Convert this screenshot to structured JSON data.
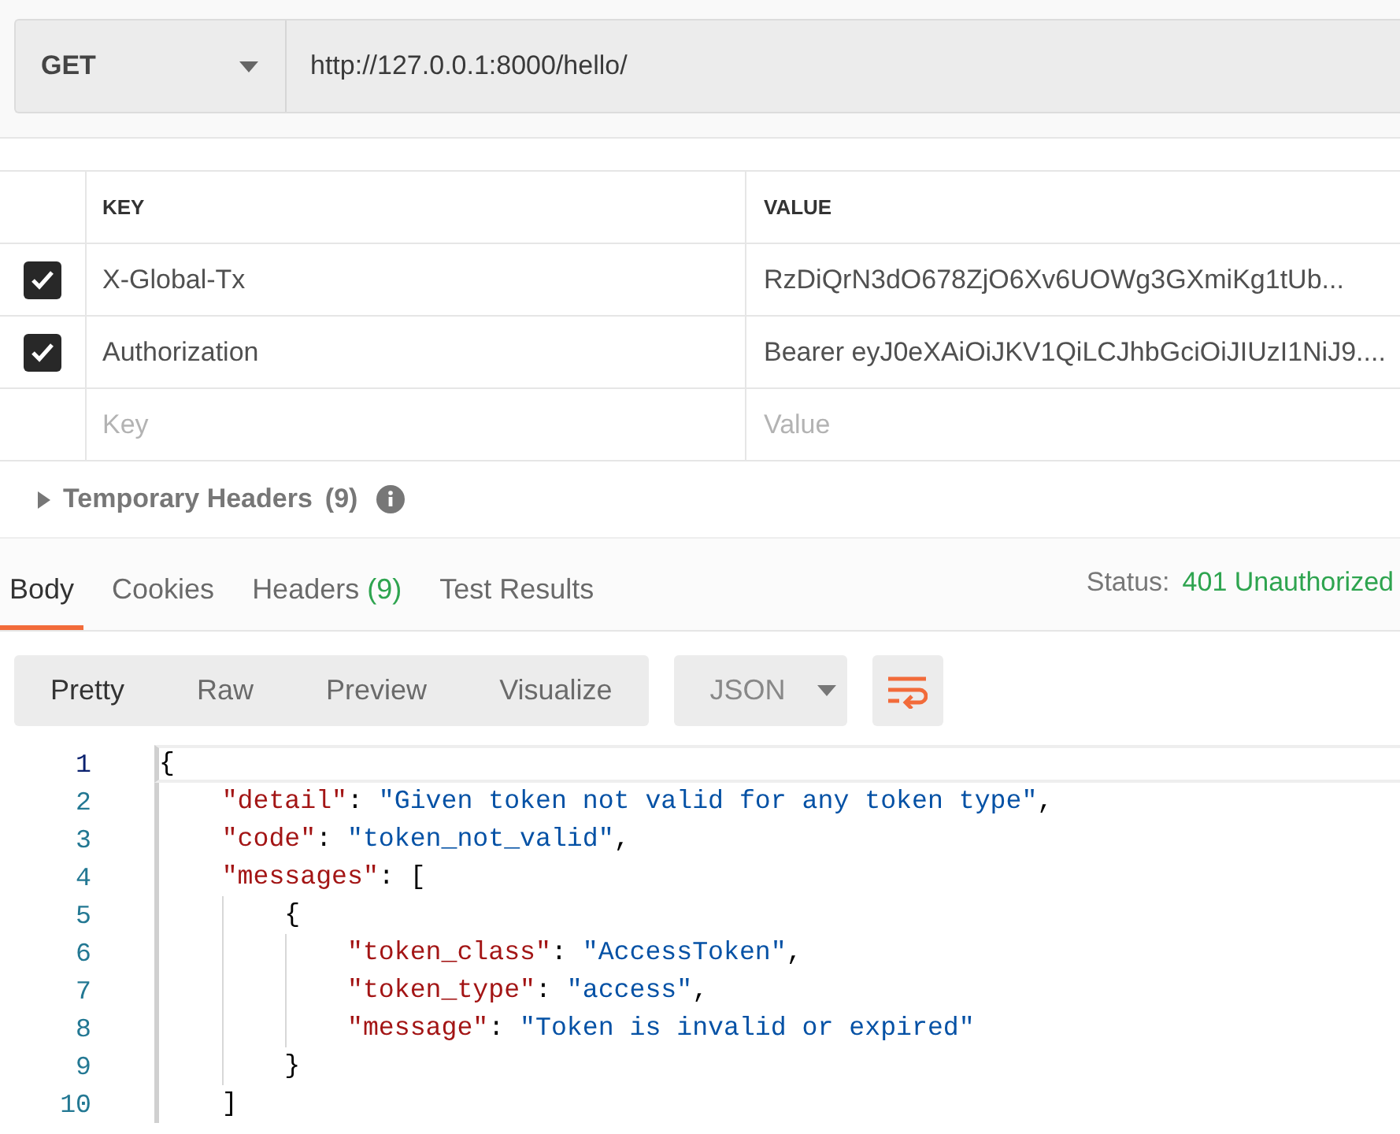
{
  "request": {
    "method": "GET",
    "url": "http://127.0.0.1:8000/hello/"
  },
  "headers_table": {
    "columns": [
      "KEY",
      "VALUE"
    ],
    "rows": [
      {
        "checked": true,
        "key": "X-Global-Tx",
        "value": "RzDiQrN3dO678ZjO6Xv6UOWg3GXmiKg1tUb..."
      },
      {
        "checked": true,
        "key": "Authorization",
        "value": "Bearer eyJ0eXAiOiJKV1QiLCJhbGciOiJIUzI1NiJ9...."
      }
    ],
    "new_row": {
      "key_placeholder": "Key",
      "value_placeholder": "Value"
    }
  },
  "temporary_headers": {
    "title": "Temporary Headers",
    "count": "(9)",
    "expanded": false
  },
  "response_tabs": [
    {
      "label": "Body",
      "selected": true
    },
    {
      "label": "Cookies",
      "selected": false
    },
    {
      "label": "Headers",
      "count": "(9)",
      "selected": false
    },
    {
      "label": "Test Results",
      "selected": false
    }
  ],
  "status": {
    "label": "Status:",
    "value": "401 Unauthorized"
  },
  "view_modes": [
    {
      "label": "Pretty",
      "selected": true
    },
    {
      "label": "Raw",
      "selected": false
    },
    {
      "label": "Preview",
      "selected": false
    },
    {
      "label": "Visualize",
      "selected": false
    }
  ],
  "format": "JSON",
  "code_lines": [
    {
      "number": "1",
      "tokens": [
        {
          "kind": "punct",
          "text": "{"
        }
      ]
    },
    {
      "number": "2",
      "tokens": [
        {
          "kind": "key",
          "text": "    \"detail\""
        },
        {
          "kind": "punct",
          "text": ": "
        },
        {
          "kind": "string",
          "text": "\"Given token not valid for any token type\""
        },
        {
          "kind": "punct",
          "text": ","
        }
      ]
    },
    {
      "number": "3",
      "tokens": [
        {
          "kind": "key",
          "text": "    \"code\""
        },
        {
          "kind": "punct",
          "text": ": "
        },
        {
          "kind": "string",
          "text": "\"token_not_valid\""
        },
        {
          "kind": "punct",
          "text": ","
        }
      ]
    },
    {
      "number": "4",
      "tokens": [
        {
          "kind": "key",
          "text": "    \"messages\""
        },
        {
          "kind": "punct",
          "text": ": ["
        }
      ]
    },
    {
      "number": "5",
      "tokens": [
        {
          "kind": "punct",
          "text": "        {"
        }
      ]
    },
    {
      "number": "6",
      "tokens": [
        {
          "kind": "key",
          "text": "            \"token_class\""
        },
        {
          "kind": "punct",
          "text": ": "
        },
        {
          "kind": "string",
          "text": "\"AccessToken\""
        },
        {
          "kind": "punct",
          "text": ","
        }
      ]
    },
    {
      "number": "7",
      "tokens": [
        {
          "kind": "key",
          "text": "            \"token_type\""
        },
        {
          "kind": "punct",
          "text": ": "
        },
        {
          "kind": "string",
          "text": "\"access\""
        },
        {
          "kind": "punct",
          "text": ","
        }
      ]
    },
    {
      "number": "8",
      "tokens": [
        {
          "kind": "key",
          "text": "            \"message\""
        },
        {
          "kind": "punct",
          "text": ": "
        },
        {
          "kind": "string",
          "text": "\"Token is invalid or expired\""
        }
      ]
    },
    {
      "number": "9",
      "tokens": [
        {
          "kind": "punct",
          "text": "        }"
        }
      ]
    },
    {
      "number": "10",
      "tokens": [
        {
          "kind": "punct",
          "text": "    ]"
        }
      ]
    }
  ]
}
